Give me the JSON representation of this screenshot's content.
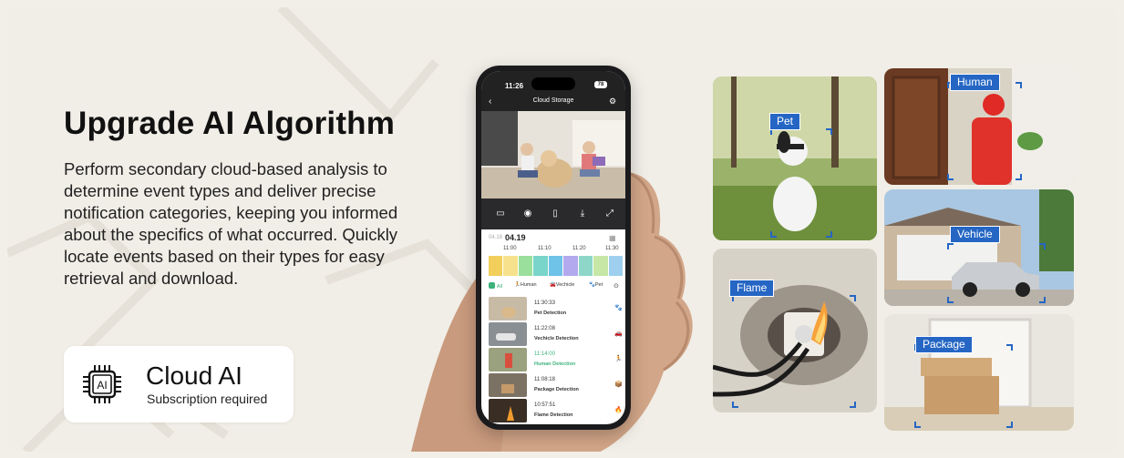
{
  "headline": "Upgrade AI Algorithm",
  "description": "Perform secondary cloud-based analysis to determine event types and deliver precise notification categories, keeping you informed about the specifics of what occurred. Quickly locate events based on their types for easy retrieval and download.",
  "badge": {
    "chip_text": "AI",
    "title": "Cloud AI",
    "subtitle": "Subscription required"
  },
  "phone": {
    "time": "11:26",
    "battery": "78",
    "nav_title": "Cloud Storage",
    "date_prev": "04.18",
    "date_current": "04.19",
    "timeline_ticks": [
      "11:00",
      "11:10",
      "11:20",
      "11:30"
    ],
    "timeline_colors": [
      "#f2cf5b",
      "#f6e28c",
      "#9adf9b",
      "#79d4c9",
      "#6fc2e8",
      "#b2a9ee",
      "#8ed7c8",
      "#c6e7a5",
      "#9ecfee"
    ],
    "filters": [
      {
        "label": "All",
        "color": "#3cb37a"
      },
      {
        "label": "Human",
        "color": "#3cb37a"
      },
      {
        "label": "Vechicle",
        "color": "#7b6fd8"
      },
      {
        "label": "Pet",
        "color": "#2fa9c9"
      }
    ],
    "events": [
      {
        "time": "11:30:33",
        "label": "Pet Detection",
        "icon": "🐾",
        "color": "#2fa9c9"
      },
      {
        "time": "11:22:08",
        "label": "Vechicle Detection",
        "icon": "🚗",
        "color": "#7b6fd8"
      },
      {
        "time": "11:14:00",
        "label": "Human Detection",
        "icon": "🏃",
        "color": "#3cb37a"
      },
      {
        "time": "11:08:18",
        "label": "Package Detection",
        "icon": "📦",
        "color": "#e9b526"
      },
      {
        "time": "10:57:51",
        "label": "Flame Detection",
        "icon": "🔥",
        "color": "#e0513b"
      }
    ]
  },
  "tiles": {
    "pet": "Pet",
    "human": "Human",
    "flame": "Flame",
    "vehicle": "Vehicle",
    "package": "Package"
  },
  "colors": {
    "tag_blue": "#2566c4",
    "active_green": "#3cb37a"
  }
}
